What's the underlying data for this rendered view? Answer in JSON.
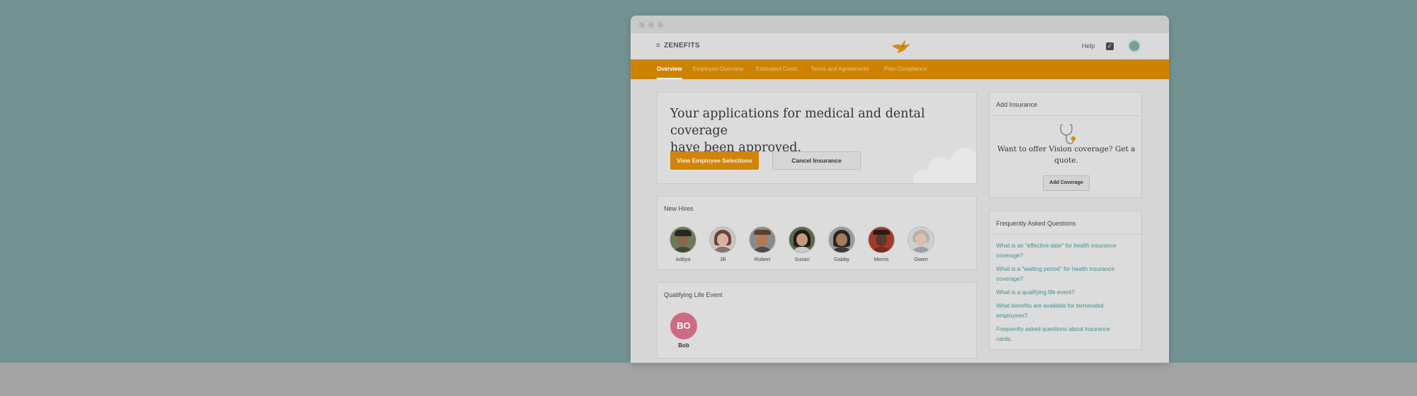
{
  "header": {
    "brand": "ZENEFITS",
    "menu_icon": "≡",
    "help": "Help",
    "check_icon": "✓"
  },
  "tabs": [
    "Overview",
    "Employee Overview",
    "Estimated Costs",
    "Terms and Agreements",
    "Plan Compliance"
  ],
  "hero": {
    "line1": "Your applications for medical and dental coverage",
    "line2": "have been approved.",
    "primary_button": "View Employee Selections",
    "secondary_button": "Cancel Insurance"
  },
  "new_hires": {
    "title": "New Hires",
    "people": [
      {
        "name": "Aditya"
      },
      {
        "name": "Jill"
      },
      {
        "name": "Robert"
      },
      {
        "name": "Susan"
      },
      {
        "name": "Gabby"
      },
      {
        "name": "Morris"
      },
      {
        "name": "Gwen"
      }
    ]
  },
  "qle": {
    "title": "Qualifying Life Event",
    "initials": "BO",
    "name": "Bob"
  },
  "add_insurance": {
    "title": "Add Insurance",
    "text_line1": "Want to offer Vision coverage? Get a",
    "text_line2": "quote.",
    "button": "Add Coverage"
  },
  "faq": {
    "title": "Frequently Asked Questions",
    "items": [
      {
        "line1": "What is an \"effective date\" for health insurance",
        "line2": "coverage?"
      },
      {
        "line1": "What is a \"waiting period\" for health insurance",
        "line2": "coverage?"
      },
      {
        "line1": "What is a qualifying life event?",
        "line2": ""
      },
      {
        "line1": "What benefits are available for terminated",
        "line2": "employees?"
      },
      {
        "line1": "Frequently asked questions about insurance",
        "line2": "cards."
      }
    ]
  },
  "colors": {
    "background": "#739393",
    "accent_orange": "#cd8300",
    "link": "#3f8f8e",
    "bo_badge": "#cd6a84"
  }
}
